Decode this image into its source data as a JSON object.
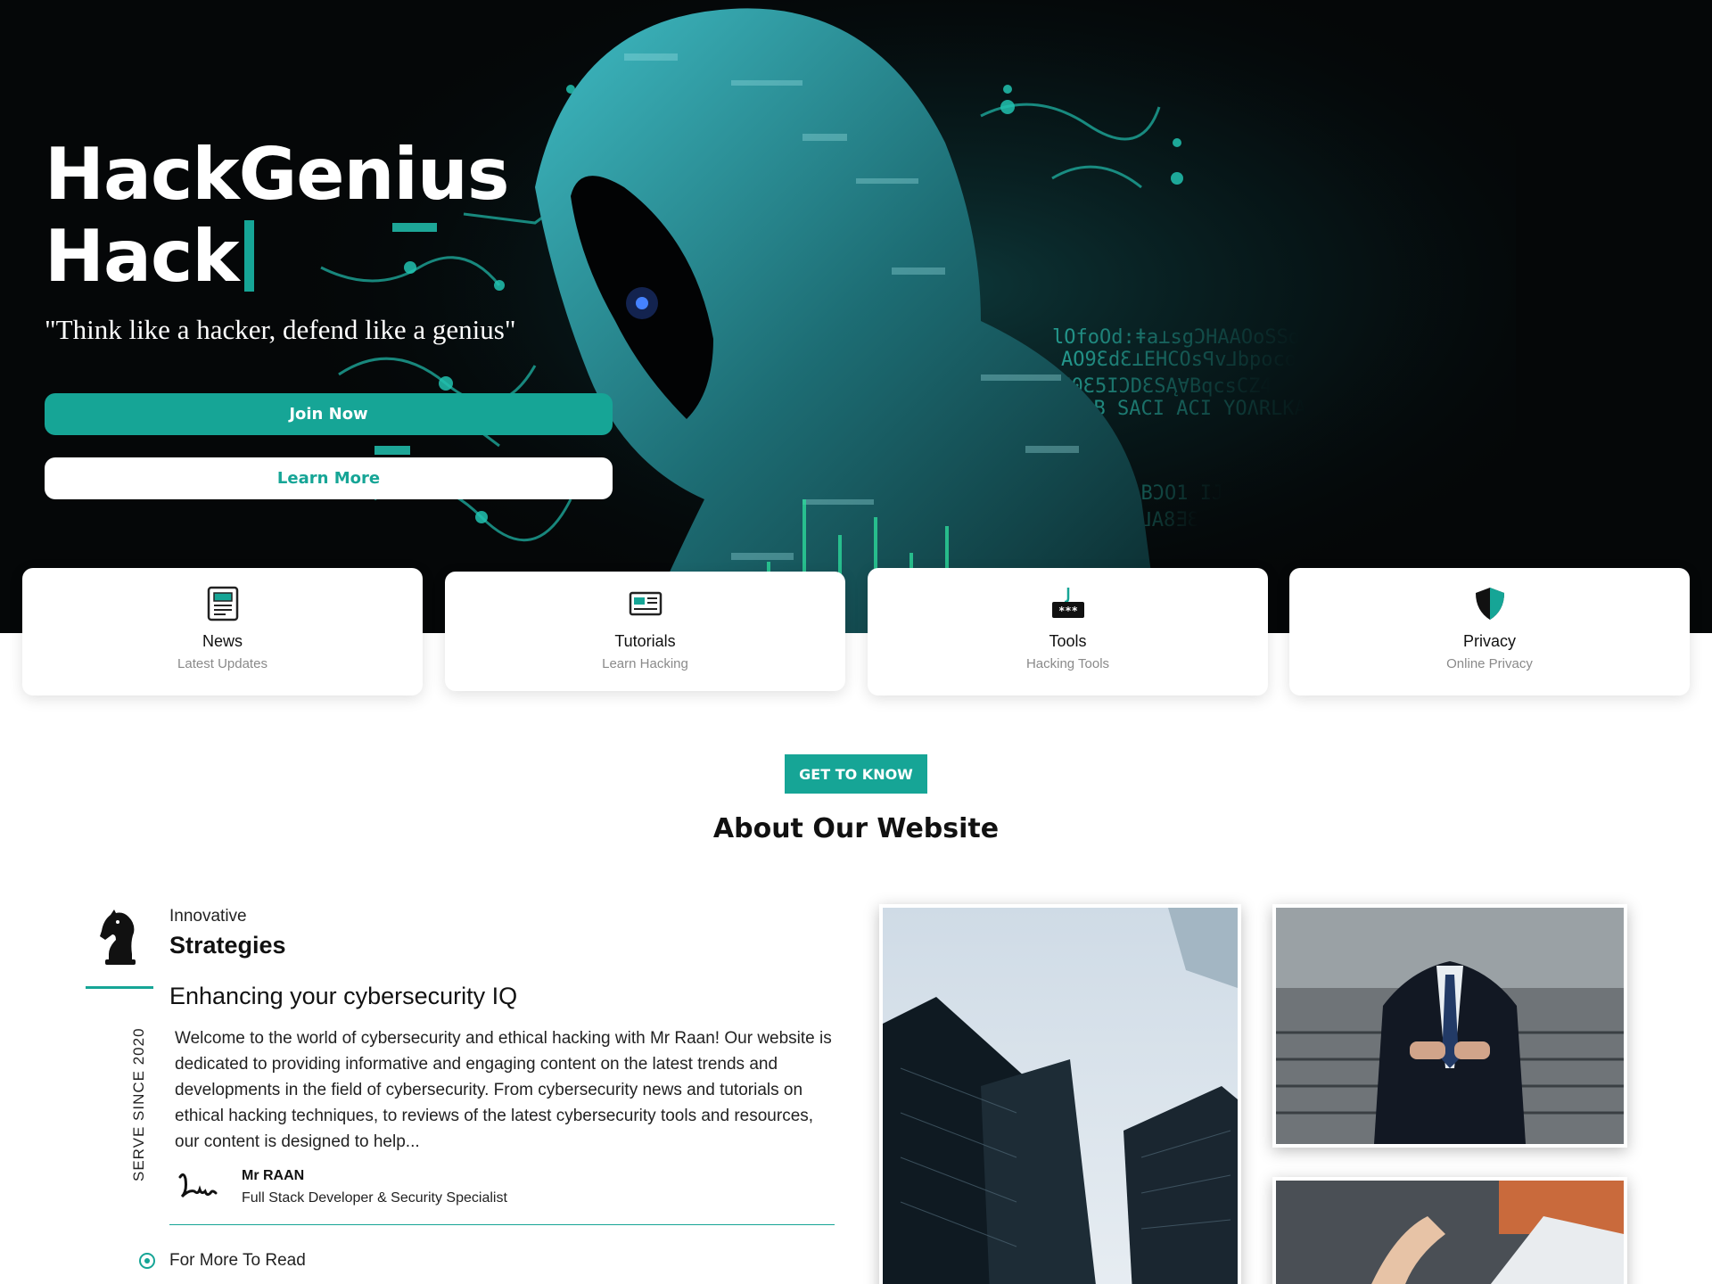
{
  "hero": {
    "title_line1": "HackGenius",
    "title_line2": "Hack",
    "quote": "\"Think like a hacker, defend like a genius\"",
    "join_label": "Join Now",
    "learn_label": "Learn More",
    "hacker_code_text": [
      "lOfoOd:ǂa⊥sgƆHAAOoSSd",
      "AO9ƐdƐ⊥EHCOsꟼv⅃bpoco",
      "LI0Ɛ5IƆDƐSĄ∀BqcsCZ4",
      "ɅʍB SACI ACI YOɅRLKA",
      "ꟼVЯOO BƆO1 IJ",
      "BAƎ0ƆƐ⅃A8ƎƐ"
    ]
  },
  "cards": [
    {
      "title": "News",
      "subtitle": "Latest Updates",
      "icon": "newspaper-icon"
    },
    {
      "title": "Tutorials",
      "subtitle": "Learn Hacking",
      "icon": "dashboard-icon"
    },
    {
      "title": "Tools",
      "subtitle": "Hacking Tools",
      "icon": "password-phishing-icon",
      "icon_text": "***"
    },
    {
      "title": "Privacy",
      "subtitle": "Online Privacy",
      "icon": "shield-icon"
    }
  ],
  "about": {
    "badge": "GET TO KNOW",
    "title": "About Our Website",
    "small_label": "Innovative",
    "heading": "Strategies",
    "vertical_text": "SERVE SINCE 2020",
    "subtitle": "Enhancing your cybersecurity IQ",
    "body": "Welcome to the world of cybersecurity and ethical hacking with Mr Raan! Our website is dedicated to providing informative and engaging content on the latest trends and developments in the field of cybersecurity. From cybersecurity news and tutorials on ethical hacking techniques, to reviews of the latest cybersecurity tools and resources, our content is designed to help...",
    "author_name": "Mr RAAN",
    "author_role": "Full Stack Developer & Security Specialist",
    "more_label": "For More To Read"
  },
  "colors": {
    "accent": "#16a596",
    "hero_bg": "#050708"
  }
}
